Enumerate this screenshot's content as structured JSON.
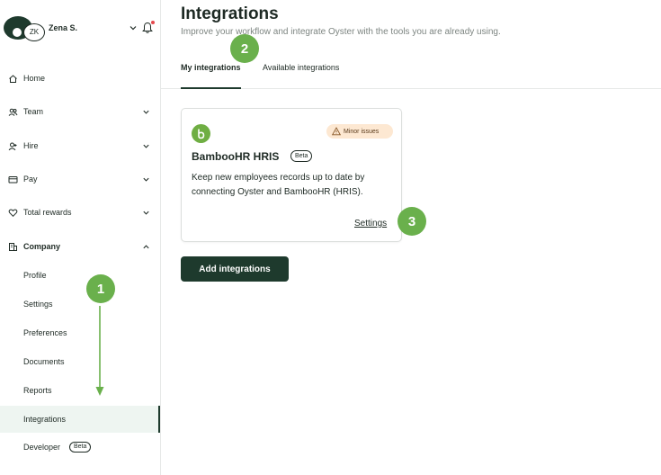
{
  "user": {
    "initials": "ZK",
    "name": "Zena S."
  },
  "sidebar": {
    "items": [
      {
        "label": "Home",
        "icon": "home-icon",
        "has_chevron": false
      },
      {
        "label": "Team",
        "icon": "team-icon",
        "has_chevron": true
      },
      {
        "label": "Hire",
        "icon": "hire-icon",
        "has_chevron": true
      },
      {
        "label": "Pay",
        "icon": "pay-icon",
        "has_chevron": true
      },
      {
        "label": "Total rewards",
        "icon": "heart-icon",
        "has_chevron": true
      },
      {
        "label": "Company",
        "icon": "building-icon",
        "has_chevron": true
      }
    ],
    "company_sub": [
      "Profile",
      "Settings",
      "Preferences",
      "Documents",
      "Reports",
      "Integrations",
      "Developer"
    ],
    "developer_badge": "Beta",
    "active_sub": "Integrations"
  },
  "header": {
    "title": "Integrations",
    "subtitle": "Improve your workflow and integrate Oyster with the tools you are already using."
  },
  "tabs": [
    "My integrations",
    "Available integrations"
  ],
  "card": {
    "name": "BambooHR HRIS",
    "beta_label": "Beta",
    "status": "Minor issues",
    "description": "Keep new employees records up to date by connecting Oyster and BambooHR (HRIS).",
    "settings_label": "Settings"
  },
  "add_button": "Add integrations",
  "annotations": [
    "1",
    "2",
    "3"
  ],
  "colors": {
    "brand": "#1e3a2d",
    "marker": "#6ab04c",
    "warning_bg": "#fde8d2",
    "bamboo": "#6fae43"
  }
}
